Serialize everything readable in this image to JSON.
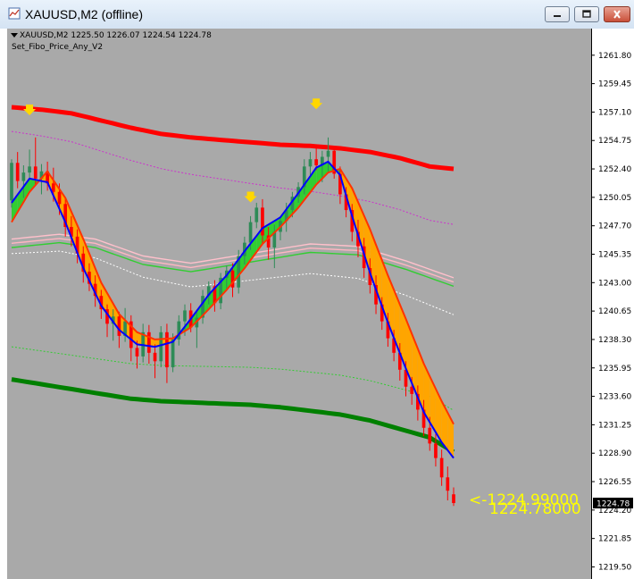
{
  "window": {
    "title": "XAUUSD,M2 (offline)",
    "icons": [
      "chart-window-icon",
      "minimize-icon",
      "maximize-icon",
      "close-icon"
    ]
  },
  "header": {
    "symbol_line": "XAUUSD,M2  1225.50 1226.07 1224.54 1224.78",
    "indicator": "Set_Fibo_Price_Any_V2"
  },
  "colors": {
    "background": "#a9a9a9",
    "bull_candle": "#2e8b57",
    "bear_candle": "#ff0000",
    "upper_band": "#ff0000",
    "lower_band": "#008000",
    "fast_ma": "#0000ff",
    "slow_ma": "#ff3300",
    "ribbon_up": "#32cd32",
    "ribbon_down": "#ffa500",
    "arrow": "#ffd700",
    "price_label": "#ffff00"
  },
  "chart_data": {
    "type": "candlestick",
    "symbol": "XAUUSD",
    "timeframe": "M2",
    "ohlc_last": {
      "open": 1225.5,
      "high": 1226.07,
      "low": 1224.54,
      "close": 1224.78
    },
    "current_price": "1224.78",
    "y_range": [
      1218.5,
      1264.0
    ],
    "y_ticks": [
      "1261.80",
      "1259.45",
      "1257.10",
      "1254.75",
      "1252.40",
      "1250.05",
      "1247.70",
      "1245.35",
      "1243.00",
      "1240.65",
      "1238.30",
      "1235.95",
      "1233.60",
      "1231.25",
      "1228.90",
      "1226.55",
      "1224.20",
      "1221.85",
      "1219.50"
    ],
    "price_labels": [
      "<-1224.99000",
      "1224.78000"
    ],
    "candles": [
      [
        1249.8,
        1253.2,
        1249.2,
        1252.9
      ],
      [
        1252.9,
        1253.8,
        1250.8,
        1251.4
      ],
      [
        1251.4,
        1252.7,
        1250.0,
        1252.1
      ],
      [
        1252.1,
        1254.0,
        1251.5,
        1252.6
      ],
      [
        1252.6,
        1255.0,
        1251.0,
        1251.6
      ],
      [
        1251.6,
        1252.8,
        1250.3,
        1252.2
      ],
      [
        1252.2,
        1253.0,
        1250.6,
        1251.2
      ],
      [
        1251.2,
        1252.5,
        1249.7,
        1250.5
      ],
      [
        1250.5,
        1251.2,
        1248.6,
        1249.5
      ],
      [
        1249.5,
        1250.0,
        1246.8,
        1247.6
      ],
      [
        1247.6,
        1248.5,
        1246.0,
        1246.8
      ],
      [
        1246.8,
        1247.4,
        1244.6,
        1245.4
      ],
      [
        1245.4,
        1246.0,
        1243.0,
        1243.9
      ],
      [
        1243.9,
        1244.6,
        1242.3,
        1242.9
      ],
      [
        1242.9,
        1243.6,
        1241.0,
        1241.9
      ],
      [
        1241.9,
        1242.4,
        1240.0,
        1240.8
      ],
      [
        1240.8,
        1241.2,
        1238.5,
        1239.6
      ],
      [
        1239.6,
        1240.8,
        1238.2,
        1240.2
      ],
      [
        1240.2,
        1240.6,
        1237.6,
        1238.6
      ],
      [
        1238.6,
        1240.9,
        1238.1,
        1239.8
      ],
      [
        1239.8,
        1240.3,
        1236.5,
        1237.6
      ],
      [
        1237.6,
        1238.2,
        1235.9,
        1236.9
      ],
      [
        1236.9,
        1239.6,
        1236.4,
        1238.9
      ],
      [
        1238.9,
        1239.5,
        1236.3,
        1237.2
      ],
      [
        1237.2,
        1237.9,
        1235.1,
        1236.5
      ],
      [
        1236.5,
        1239.4,
        1236.0,
        1238.9
      ],
      [
        1238.9,
        1239.6,
        1234.7,
        1236.0
      ],
      [
        1236.0,
        1238.8,
        1235.6,
        1238.3
      ],
      [
        1238.3,
        1240.3,
        1237.8,
        1239.8
      ],
      [
        1239.8,
        1241.2,
        1238.6,
        1240.7
      ],
      [
        1240.7,
        1241.3,
        1238.9,
        1239.3
      ],
      [
        1239.3,
        1240.6,
        1237.6,
        1240.1
      ],
      [
        1240.1,
        1242.4,
        1239.6,
        1241.9
      ],
      [
        1241.9,
        1243.1,
        1241.2,
        1242.7
      ],
      [
        1242.7,
        1243.2,
        1240.6,
        1241.3
      ],
      [
        1241.3,
        1243.8,
        1240.8,
        1243.4
      ],
      [
        1243.4,
        1244.4,
        1242.5,
        1244.0
      ],
      [
        1244.0,
        1244.6,
        1241.8,
        1242.6
      ],
      [
        1242.6,
        1245.7,
        1242.1,
        1245.2
      ],
      [
        1245.2,
        1246.8,
        1244.5,
        1246.3
      ],
      [
        1246.3,
        1248.5,
        1245.7,
        1248.0
      ],
      [
        1248.0,
        1249.6,
        1247.5,
        1249.2
      ],
      [
        1249.2,
        1249.9,
        1246.1,
        1246.9
      ],
      [
        1246.9,
        1247.6,
        1244.9,
        1245.9
      ],
      [
        1245.9,
        1247.8,
        1244.2,
        1247.2
      ],
      [
        1247.2,
        1248.4,
        1246.5,
        1248.1
      ],
      [
        1248.1,
        1249.6,
        1247.2,
        1249.0
      ],
      [
        1249.0,
        1250.5,
        1248.4,
        1250.1
      ],
      [
        1250.1,
        1251.3,
        1249.6,
        1250.9
      ],
      [
        1250.9,
        1253.2,
        1250.3,
        1252.6
      ],
      [
        1252.6,
        1253.8,
        1251.9,
        1253.2
      ],
      [
        1253.2,
        1254.3,
        1252.3,
        1252.7
      ],
      [
        1252.7,
        1253.9,
        1251.3,
        1253.4
      ],
      [
        1253.4,
        1255.0,
        1252.2,
        1253.9
      ],
      [
        1253.9,
        1254.3,
        1251.6,
        1252.0
      ],
      [
        1252.0,
        1252.6,
        1249.5,
        1250.3
      ],
      [
        1250.3,
        1250.9,
        1248.4,
        1249.0
      ],
      [
        1249.0,
        1249.5,
        1246.4,
        1247.2
      ],
      [
        1247.2,
        1248.2,
        1245.1,
        1246.0
      ],
      [
        1246.0,
        1246.7,
        1243.4,
        1244.2
      ],
      [
        1244.2,
        1245.0,
        1242.1,
        1242.8
      ],
      [
        1242.8,
        1243.6,
        1240.4,
        1241.2
      ],
      [
        1241.2,
        1241.8,
        1239.1,
        1239.8
      ],
      [
        1239.8,
        1240.5,
        1237.7,
        1238.4
      ],
      [
        1238.4,
        1239.1,
        1236.5,
        1237.2
      ],
      [
        1237.2,
        1238.0,
        1234.9,
        1235.8
      ],
      [
        1235.8,
        1236.5,
        1233.6,
        1234.4
      ],
      [
        1234.4,
        1235.2,
        1232.9,
        1233.8
      ],
      [
        1233.8,
        1234.5,
        1231.6,
        1232.5
      ],
      [
        1232.5,
        1233.3,
        1230.3,
        1231.0
      ],
      [
        1231.0,
        1231.9,
        1229.1,
        1229.7
      ],
      [
        1229.7,
        1230.5,
        1227.8,
        1228.5
      ],
      [
        1228.5,
        1229.2,
        1226.2,
        1226.9
      ],
      [
        1226.9,
        1227.8,
        1225.0,
        1225.8
      ],
      [
        1225.5,
        1226.07,
        1224.54,
        1224.78
      ]
    ],
    "upper_band": [
      [
        0,
        1257.5
      ],
      [
        5,
        1257.3
      ],
      [
        10,
        1257.0
      ],
      [
        15,
        1256.4
      ],
      [
        20,
        1255.8
      ],
      [
        25,
        1255.3
      ],
      [
        30,
        1255.0
      ],
      [
        35,
        1254.8
      ],
      [
        40,
        1254.6
      ],
      [
        45,
        1254.4
      ],
      [
        50,
        1254.3
      ],
      [
        55,
        1254.1
      ],
      [
        60,
        1253.8
      ],
      [
        65,
        1253.3
      ],
      [
        70,
        1252.6
      ],
      [
        74,
        1252.4
      ]
    ],
    "lower_band": [
      [
        0,
        1235.0
      ],
      [
        5,
        1234.6
      ],
      [
        10,
        1234.2
      ],
      [
        15,
        1233.8
      ],
      [
        20,
        1233.4
      ],
      [
        25,
        1233.2
      ],
      [
        30,
        1233.1
      ],
      [
        35,
        1233.0
      ],
      [
        40,
        1232.9
      ],
      [
        45,
        1232.7
      ],
      [
        50,
        1232.4
      ],
      [
        55,
        1232.1
      ],
      [
        60,
        1231.6
      ],
      [
        65,
        1230.9
      ],
      [
        70,
        1230.2
      ],
      [
        74,
        1229.0
      ]
    ],
    "fast_ma": [
      [
        0,
        1249.6
      ],
      [
        3,
        1251.6
      ],
      [
        6,
        1251.3
      ],
      [
        9,
        1248.0
      ],
      [
        12,
        1244.2
      ],
      [
        15,
        1241.1
      ],
      [
        18,
        1239.1
      ],
      [
        21,
        1237.9
      ],
      [
        24,
        1237.7
      ],
      [
        27,
        1238.1
      ],
      [
        30,
        1240.0
      ],
      [
        33,
        1242.0
      ],
      [
        36,
        1243.6
      ],
      [
        39,
        1245.6
      ],
      [
        42,
        1247.5
      ],
      [
        45,
        1248.4
      ],
      [
        48,
        1250.4
      ],
      [
        51,
        1252.5
      ],
      [
        53,
        1253.0
      ],
      [
        55,
        1251.9
      ],
      [
        57,
        1248.5
      ],
      [
        60,
        1243.8
      ],
      [
        63,
        1239.7
      ],
      [
        66,
        1235.9
      ],
      [
        69,
        1232.3
      ],
      [
        72,
        1229.8
      ],
      [
        74,
        1228.5
      ]
    ],
    "slow_ma": [
      [
        0,
        1248.0
      ],
      [
        3,
        1250.5
      ],
      [
        6,
        1252.2
      ],
      [
        9,
        1250.0
      ],
      [
        12,
        1246.6
      ],
      [
        15,
        1243.0
      ],
      [
        18,
        1240.4
      ],
      [
        21,
        1238.9
      ],
      [
        24,
        1238.3
      ],
      [
        27,
        1238.4
      ],
      [
        30,
        1239.3
      ],
      [
        33,
        1240.8
      ],
      [
        36,
        1242.4
      ],
      [
        39,
        1244.2
      ],
      [
        42,
        1246.2
      ],
      [
        45,
        1247.6
      ],
      [
        48,
        1249.2
      ],
      [
        51,
        1251.1
      ],
      [
        53,
        1252.1
      ],
      [
        55,
        1252.4
      ],
      [
        57,
        1250.8
      ],
      [
        60,
        1247.4
      ],
      [
        63,
        1243.6
      ],
      [
        66,
        1240.0
      ],
      [
        69,
        1236.3
      ],
      [
        72,
        1233.2
      ],
      [
        74,
        1231.3
      ]
    ]
  }
}
